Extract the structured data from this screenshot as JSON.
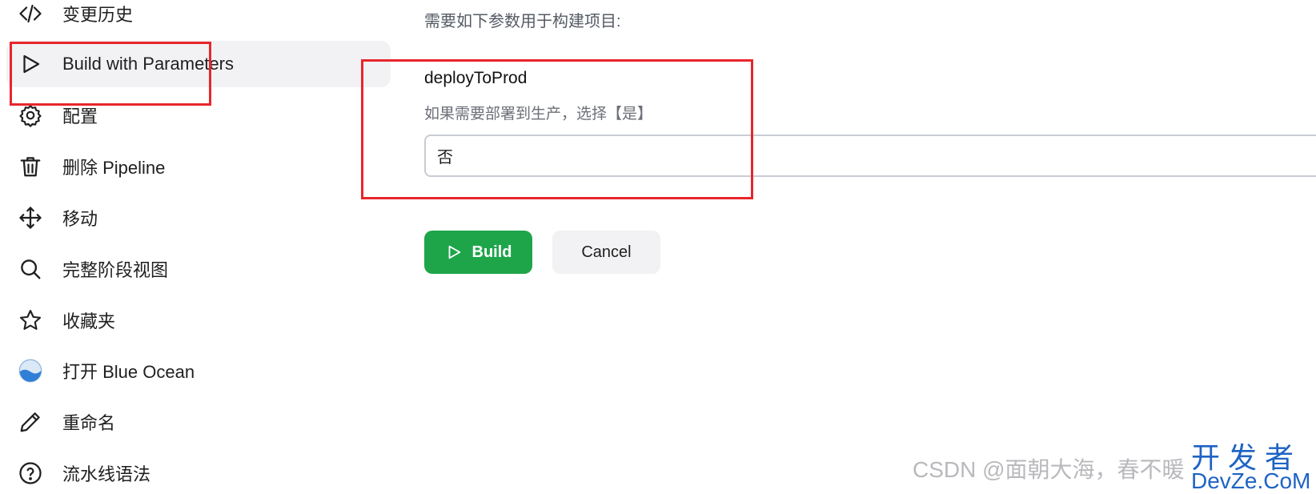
{
  "sidebar": {
    "items": [
      {
        "label": "变更历史",
        "icon": "code-icon"
      },
      {
        "label": "Build with Parameters",
        "icon": "play-icon",
        "active": true
      },
      {
        "label": "配置",
        "icon": "gear-icon"
      },
      {
        "label": "删除 Pipeline",
        "icon": "trash-icon"
      },
      {
        "label": "移动",
        "icon": "move-icon"
      },
      {
        "label": "完整阶段视图",
        "icon": "search-icon"
      },
      {
        "label": "收藏夹",
        "icon": "star-icon"
      },
      {
        "label": "打开 Blue Ocean",
        "icon": "blue-ocean-icon"
      },
      {
        "label": "重命名",
        "icon": "pencil-icon"
      },
      {
        "label": "流水线语法",
        "icon": "help-icon"
      }
    ]
  },
  "main": {
    "intro": "需要如下参数用于构建项目:",
    "parameter": {
      "name": "deployToProd",
      "description": "如果需要部署到生产，选择【是】",
      "selected_value": "否"
    },
    "buttons": {
      "build": "Build",
      "cancel": "Cancel"
    }
  },
  "watermark": {
    "text": "CSDN @面朝大海，春不暖",
    "logo_top": "开发者",
    "logo_bottom": "DevZe.CoM"
  },
  "colors": {
    "build_button": "#1ea54a",
    "annotation": "#e8262b",
    "active_bg": "#f2f2f4"
  }
}
